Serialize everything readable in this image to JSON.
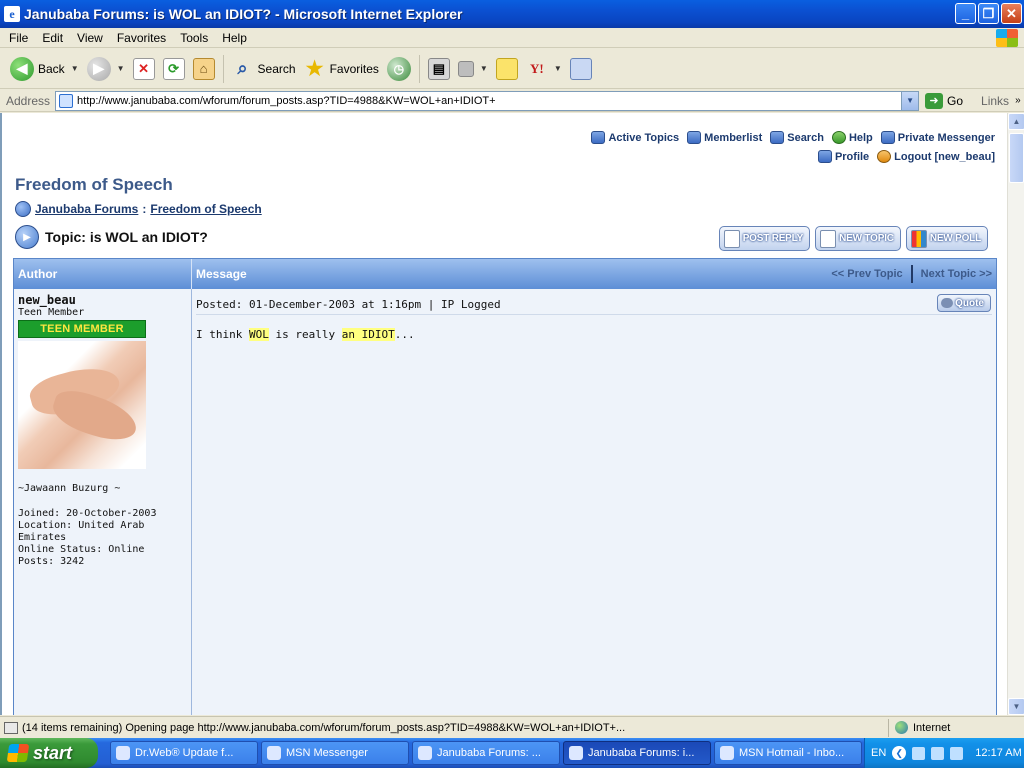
{
  "window": {
    "title": "Janubaba Forums: is WOL an IDIOT? - Microsoft Internet Explorer",
    "app_icon": "e"
  },
  "menu": [
    "File",
    "Edit",
    "View",
    "Favorites",
    "Tools",
    "Help"
  ],
  "toolbar": {
    "back_label": "Back",
    "search_label": "Search",
    "favorites_label": "Favorites"
  },
  "address": {
    "label": "Address",
    "url": "http://www.janubaba.com/wforum/forum_posts.asp?TID=4988&KW=WOL+an+IDIOT+",
    "go_label": "Go",
    "links_label": "Links"
  },
  "forum_nav": {
    "active_topics": "Active Topics",
    "memberlist": "Memberlist",
    "search": "Search",
    "help": "Help",
    "private_messenger": "Private Messenger",
    "profile": "Profile",
    "logout": "Logout [new_beau]"
  },
  "forum": {
    "title": "Freedom of Speech",
    "breadcrumb": [
      "Janubaba Forums",
      "Freedom of Speech"
    ],
    "breadcrumb_sep": ":",
    "topic_title": "Topic: is WOL an IDIOT?"
  },
  "actions": {
    "post_reply": "POST REPLY",
    "new_topic": "NEW TOPIC",
    "new_poll": "NEW POLL"
  },
  "table": {
    "author_header": "Author",
    "message_header": "Message",
    "prev_topic": "<< Prev Topic",
    "next_topic": "Next Topic >>"
  },
  "post": {
    "author": "new_beau",
    "member_title": "Teen Member",
    "rank_badge": "TEEN MEMBER",
    "signature": "~Jawaann Buzurg ~",
    "joined": "Joined: 20-October-2003",
    "location_line1": "Location: United Arab",
    "location_line2": "Emirates",
    "online_status": "Online Status: Online",
    "posts": "Posts: 3242",
    "meta": "Posted: 01-December-2003 at 1:16pm | IP Logged",
    "quote_label": "Quote",
    "text_parts": [
      "I think ",
      "WOL",
      " is really ",
      "an IDIOT",
      "..."
    ]
  },
  "status": {
    "text": "(14 items remaining) Opening page http://www.janubaba.com/wforum/forum_posts.asp?TID=4988&KW=WOL+an+IDIOT+...",
    "zone": "Internet"
  },
  "taskbar": {
    "start_label": "start",
    "items": [
      "Dr.Web® Update f...",
      "MSN Messenger",
      "Janubaba Forums: ...",
      "Janubaba Forums: i...",
      "MSN Hotmail - Inbo..."
    ],
    "active_index": 3,
    "language": "EN",
    "clock": "12:17 AM"
  }
}
